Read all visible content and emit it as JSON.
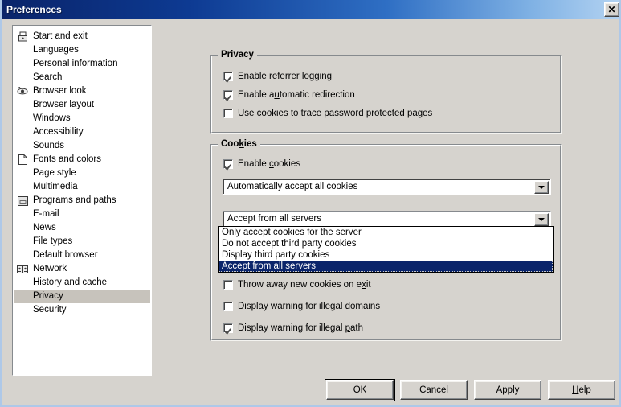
{
  "window": {
    "title": "Preferences",
    "close_label": "✕",
    "background_color": "#d6d3ce",
    "titlebar_gradient_start": "#0a246a",
    "titlebar_gradient_end": "#b5d4f2"
  },
  "sidebar": {
    "items": [
      {
        "label": "Start and exit",
        "icon": "lock-icon",
        "selected": false
      },
      {
        "label": "Languages",
        "icon": "",
        "selected": false
      },
      {
        "label": "Personal information",
        "icon": "",
        "selected": false
      },
      {
        "label": "Search",
        "icon": "",
        "selected": false
      },
      {
        "label": "Browser look",
        "icon": "eye-icon",
        "selected": false
      },
      {
        "label": "Browser layout",
        "icon": "",
        "selected": false
      },
      {
        "label": "Windows",
        "icon": "",
        "selected": false
      },
      {
        "label": "Accessibility",
        "icon": "",
        "selected": false
      },
      {
        "label": "Sounds",
        "icon": "",
        "selected": false
      },
      {
        "label": "Fonts and colors",
        "icon": "page-icon",
        "selected": false
      },
      {
        "label": "Page style",
        "icon": "",
        "selected": false
      },
      {
        "label": "Multimedia",
        "icon": "",
        "selected": false
      },
      {
        "label": "Programs and paths",
        "icon": "window-icon",
        "selected": false
      },
      {
        "label": "E-mail",
        "icon": "",
        "selected": false
      },
      {
        "label": "News",
        "icon": "",
        "selected": false
      },
      {
        "label": "File types",
        "icon": "",
        "selected": false
      },
      {
        "label": "Default browser",
        "icon": "",
        "selected": false
      },
      {
        "label": "Network",
        "icon": "network-icon",
        "selected": false
      },
      {
        "label": "History and cache",
        "icon": "",
        "selected": false
      },
      {
        "label": "Privacy",
        "icon": "",
        "selected": true
      },
      {
        "label": "Security",
        "icon": "",
        "selected": false
      }
    ]
  },
  "privacy_group": {
    "title": "Privacy",
    "checkboxes": [
      {
        "pre": "",
        "accel": "E",
        "post": "nable referrer logging",
        "checked": true
      },
      {
        "pre": "Enable a",
        "accel": "u",
        "post": "tomatic redirection",
        "checked": true
      },
      {
        "pre": "Use c",
        "accel": "o",
        "post": "okies to trace password protected pages",
        "checked": false
      }
    ]
  },
  "cookies_group": {
    "title_pre": "Coo",
    "title_accel": "k",
    "title_post": "ies",
    "title": "Cookies",
    "enable_checkbox": {
      "pre": "Enable ",
      "accel": "c",
      "post": "ookies",
      "checked": true
    },
    "combo_accept": {
      "value": "Automatically accept all cookies",
      "arrow_icon": "chevron-down-icon"
    },
    "combo_servers": {
      "value": "Accept from all servers",
      "arrow_icon": "chevron-down-icon"
    },
    "dropdown_options": [
      {
        "label": "Only accept cookies for the server",
        "selected": false
      },
      {
        "label": "Do not accept third party cookies",
        "selected": false
      },
      {
        "label": "Display third party cookies",
        "selected": false
      },
      {
        "label": "Accept from all servers",
        "selected": true
      }
    ],
    "selection_color": "#0a246a",
    "checkboxes": [
      {
        "pre": "Throw away new cookies on e",
        "accel": "x",
        "post": "it",
        "checked": false
      },
      {
        "pre": "Display ",
        "accel": "w",
        "post": "arning for illegal domains",
        "checked": false
      },
      {
        "pre": "Display warning for illegal ",
        "accel": "p",
        "post": "ath",
        "checked": true
      }
    ]
  },
  "buttons": {
    "ok": "OK",
    "cancel": "Cancel",
    "apply": "Apply",
    "help_pre": "",
    "help_accel": "H",
    "help_post": "elp",
    "help": "Help"
  }
}
